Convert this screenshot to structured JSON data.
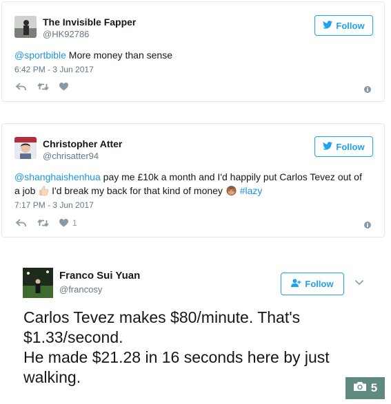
{
  "tweets": [
    {
      "name": "The Invisible Fapper",
      "handle": "@HK92786",
      "follow_label": "Follow",
      "mention": "@sportbible",
      "text": " More money than sense",
      "timestamp": "6:42 PM - 3 Jun 2017"
    },
    {
      "name": "Christopher Atter",
      "handle": "@chrisatter94",
      "follow_label": "Follow",
      "mention": "@shanghaishenhua",
      "text_1": " pay me £10k a month and I'd happily put Carlos Tevez out of",
      "text_2a": "a job ",
      "text_2b": " I'd break my back for that kind of money ",
      "hashtag": "#lazy",
      "timestamp": "7:17 PM - 3 Jun 2017",
      "like_count": "1"
    }
  ],
  "embedded": {
    "name": "Franco Sui Yuan",
    "handle": "@francosy",
    "follow_label": "Follow",
    "line_1": "Carlos Tevez makes $80/minute. That's",
    "line_2": "$1.33/second.",
    "line_3": "He made $21.28 in 16 seconds here by just",
    "line_4": "walking.",
    "photo_count": "5"
  },
  "colors": {
    "twitter_blue": "#1da1f2",
    "link_blue": "#1b95e0",
    "muted": "#657786",
    "photo_badge": "#5f8a80"
  }
}
